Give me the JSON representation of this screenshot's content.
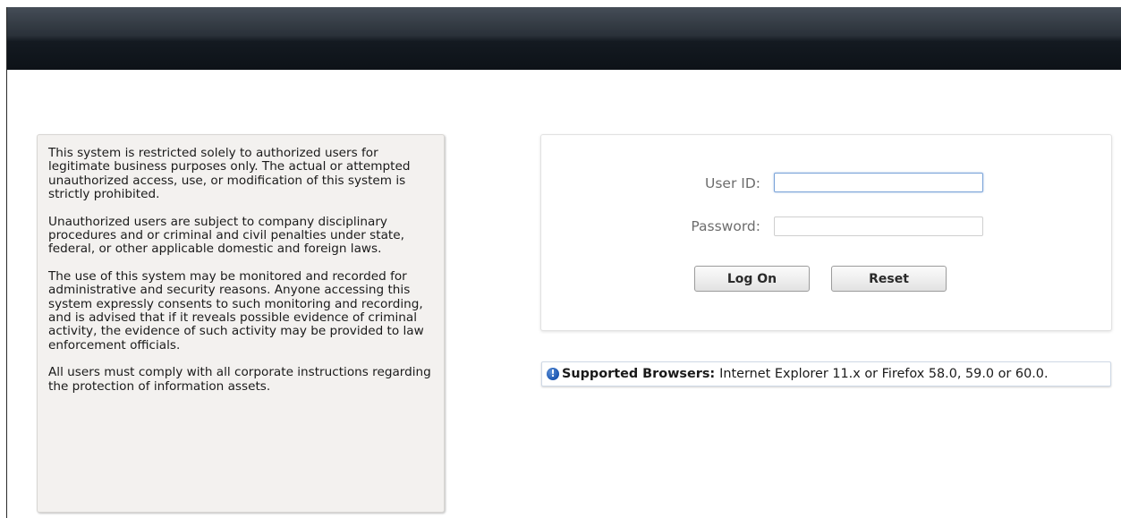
{
  "notice": {
    "paragraph1": "This system is restricted solely to authorized users for legitimate business purposes only. The actual or attempted unauthorized access, use, or modification of this system is strictly prohibited.",
    "paragraph2": "Unauthorized users are subject to company disciplinary procedures and or criminal and civil penalties under state, federal, or other applicable domestic and foreign laws.",
    "paragraph3": "The use of this system may be monitored and recorded for administrative and security reasons. Anyone accessing this system expressly consents to such monitoring and recording, and is advised that if it reveals possible evidence of criminal activity, the evidence of such activity may be provided to law enforcement officials.",
    "paragraph4": "All users must comply with all corporate instructions regarding the protection of information assets."
  },
  "login": {
    "user_label": "User ID:",
    "user_value": "",
    "password_label": "Password:",
    "password_value": "",
    "logon_label": "Log On",
    "reset_label": "Reset"
  },
  "browsers": {
    "icon": "info-icon",
    "icon_glyph": "!",
    "heading": "Supported Browsers:",
    "text": "Internet Explorer 11.x or Firefox 58.0, 59.0 or 60.0."
  }
}
